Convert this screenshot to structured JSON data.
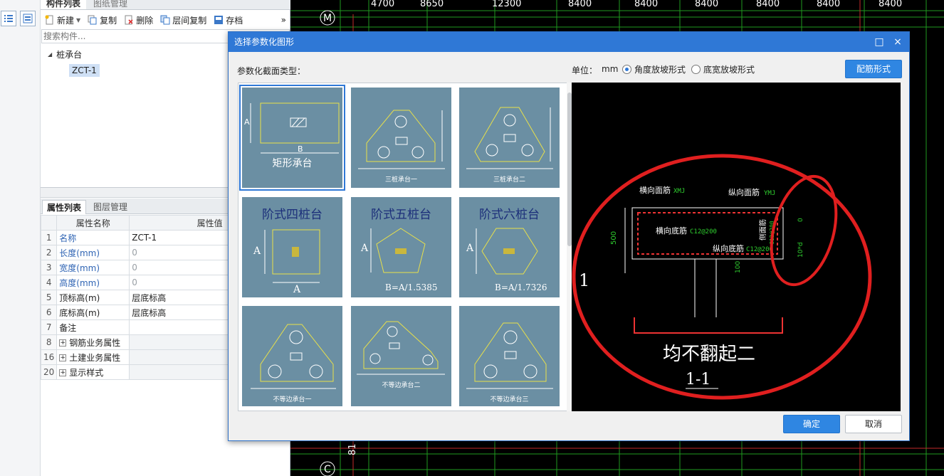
{
  "left_strip": {
    "icons": [
      "list-view-icon",
      "tile-view-icon"
    ]
  },
  "component_panel": {
    "tabs": [
      "构件列表",
      "图纸管理"
    ],
    "toolbar": {
      "new": "新建",
      "copy": "复制",
      "delete": "删除",
      "floor_copy": "层间复制",
      "save": "存档",
      "more": "»"
    },
    "search_placeholder": "搜索构件...",
    "tree": {
      "root": "桩承台",
      "leaf": "ZCT-1"
    }
  },
  "properties_panel": {
    "tabs": [
      "属性列表",
      "图层管理"
    ],
    "headers": {
      "name": "属性名称",
      "value": "属性值"
    },
    "rows": [
      {
        "num": "1",
        "name": "名称",
        "value": "ZCT-1"
      },
      {
        "num": "2",
        "name": "长度(mm)",
        "value": "0"
      },
      {
        "num": "3",
        "name": "宽度(mm)",
        "value": "0"
      },
      {
        "num": "4",
        "name": "高度(mm)",
        "value": "0"
      },
      {
        "num": "5",
        "name": "顶标高(m)",
        "value": "层底标高"
      },
      {
        "num": "6",
        "name": "底标高(m)",
        "value": "层底标高"
      },
      {
        "num": "7",
        "name": "备注",
        "value": ""
      },
      {
        "num": "8",
        "name": "钢筋业务属性",
        "value": ""
      },
      {
        "num": "16",
        "name": "土建业务属性",
        "value": ""
      },
      {
        "num": "20",
        "name": "显示样式",
        "value": ""
      }
    ]
  },
  "cad": {
    "top_dims": [
      "4700",
      "8650",
      "12300",
      "8400",
      "8400",
      "8400",
      "8400",
      "8400",
      "8400"
    ],
    "axis_M": "M",
    "axis_C": "C",
    "bottom_number": "81"
  },
  "dialog": {
    "title": "选择参数化图形",
    "max_icon": "□",
    "close_icon": "×",
    "section_type_label": "参数化截面类型：",
    "unit_label": "单位：",
    "unit_value": "mm",
    "radio_angle": "角度放坡形式",
    "radio_width": "底宽放坡形式",
    "rebar_button": "配筋形式",
    "ok": "确定",
    "cancel": "取消",
    "thumbnails": [
      {
        "caption": "矩形承台",
        "dim_a": "A",
        "dim_b": "B"
      },
      {
        "caption": "三桩承台一"
      },
      {
        "caption": "三桩承台二"
      },
      {
        "caption": "阶式四桩台",
        "dim_a": "A",
        "dim_b": "A"
      },
      {
        "caption": "阶式五桩台",
        "dim_a": "A",
        "formula": "B=A/1.5385"
      },
      {
        "caption": "阶式六桩台",
        "dim_a": "A",
        "formula": "B=A/1.7326"
      },
      {
        "caption": "不等边承台一"
      },
      {
        "caption": "不等边承台二"
      },
      {
        "caption": "不等边承台三"
      }
    ],
    "preview": {
      "top_bar_label": "横向面筋",
      "top_bar_code": "XMJ",
      "long_top_label": "纵向面筋",
      "long_top_code": "YMJ",
      "bottom_bar_label": "横向底筋",
      "bottom_bar_code": "C12@200",
      "long_bottom_label": "纵向底筋",
      "long_bottom_code": "C12@200",
      "side_label": "侧面筋",
      "side_code": "C12@200",
      "dim_500": "500",
      "dim_100": "100",
      "dim_0": "0",
      "dim_10d": "10*d",
      "caption": "均不翻起二",
      "section": "1-1",
      "side_number": "1"
    }
  }
}
